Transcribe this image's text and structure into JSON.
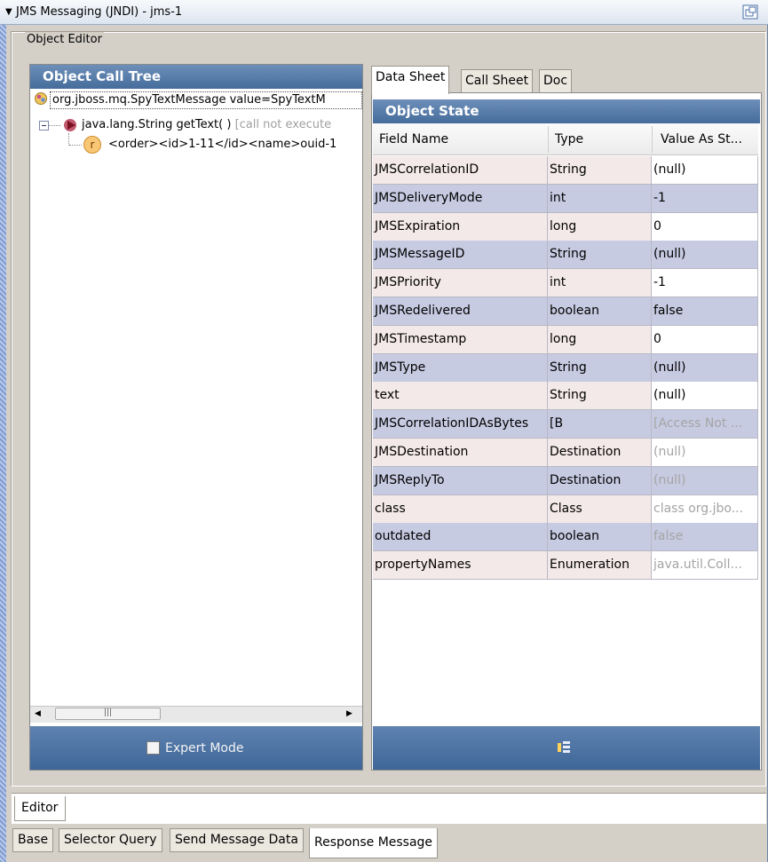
{
  "window": {
    "title": "JMS Messaging (JNDI) - jms-1"
  },
  "object_editor": {
    "title": "Object Editor"
  },
  "call_tree": {
    "header": "Object Call Tree",
    "rows": [
      {
        "text": "org.jboss.mq.SpyTextMessage value=SpyTextM",
        "muted": ""
      },
      {
        "text": "java.lang.String getText( )",
        "muted": "[call not execute"
      },
      {
        "text": "<order><id>1-11</id><name>ouid-1",
        "muted": ""
      }
    ],
    "expert_mode_label": "Expert Mode"
  },
  "tabs": [
    "Data Sheet",
    "Call Sheet",
    "Doc"
  ],
  "object_state": {
    "header": "Object State",
    "columns": [
      "Field Name",
      "Type",
      "Value As St..."
    ],
    "rows": [
      {
        "field": "JMSCorrelationID",
        "type": "String",
        "value": "(null)"
      },
      {
        "field": "JMSDeliveryMode",
        "type": "int",
        "value": "-1"
      },
      {
        "field": "JMSExpiration",
        "type": "long",
        "value": "0"
      },
      {
        "field": "JMSMessageID",
        "type": "String",
        "value": "(null)"
      },
      {
        "field": "JMSPriority",
        "type": "int",
        "value": "-1"
      },
      {
        "field": "JMSRedelivered",
        "type": "boolean",
        "value": "false"
      },
      {
        "field": "JMSTimestamp",
        "type": "long",
        "value": "0"
      },
      {
        "field": "JMSType",
        "type": "String",
        "value": "(null)"
      },
      {
        "field": "text",
        "type": "String",
        "value": "(null)"
      },
      {
        "field": "JMSCorrelationIDAsBytes",
        "type": "[B",
        "value": "[Access Not ..."
      },
      {
        "field": "JMSDestination",
        "type": "Destination",
        "value": "(null)"
      },
      {
        "field": "JMSReplyTo",
        "type": "Destination",
        "value": "(null)"
      },
      {
        "field": "class",
        "type": "Class",
        "value": "class org.jbo..."
      },
      {
        "field": "outdated",
        "type": "boolean",
        "value": "false"
      },
      {
        "field": "propertyNames",
        "type": "Enumeration",
        "value": "java.util.Coll..."
      }
    ]
  },
  "editor_tab": "Editor",
  "bottom_tabs": [
    "Base",
    "Selector Query",
    "Send Message Data",
    "Response Message"
  ],
  "tree_node_badge": "r"
}
